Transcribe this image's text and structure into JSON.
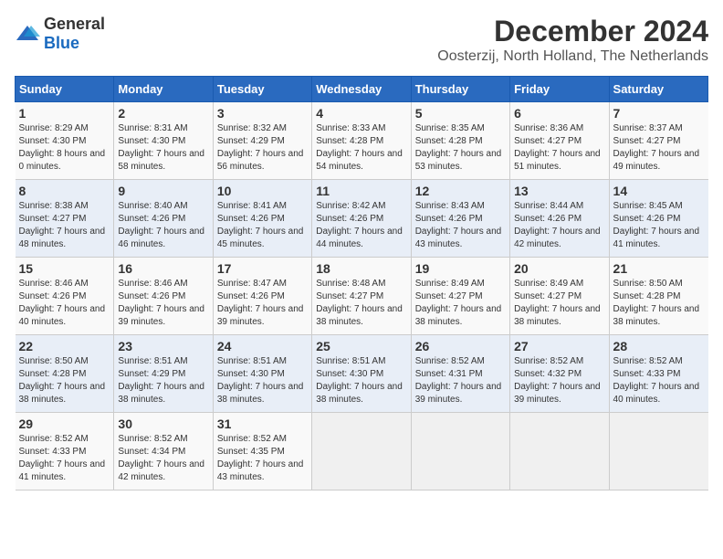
{
  "header": {
    "logo_general": "General",
    "logo_blue": "Blue",
    "main_title": "December 2024",
    "subtitle": "Oosterzij, North Holland, The Netherlands"
  },
  "calendar": {
    "weekdays": [
      "Sunday",
      "Monday",
      "Tuesday",
      "Wednesday",
      "Thursday",
      "Friday",
      "Saturday"
    ],
    "weeks": [
      [
        {
          "day": "1",
          "sunrise": "Sunrise: 8:29 AM",
          "sunset": "Sunset: 4:30 PM",
          "daylight": "Daylight: 8 hours and 0 minutes."
        },
        {
          "day": "2",
          "sunrise": "Sunrise: 8:31 AM",
          "sunset": "Sunset: 4:30 PM",
          "daylight": "Daylight: 7 hours and 58 minutes."
        },
        {
          "day": "3",
          "sunrise": "Sunrise: 8:32 AM",
          "sunset": "Sunset: 4:29 PM",
          "daylight": "Daylight: 7 hours and 56 minutes."
        },
        {
          "day": "4",
          "sunrise": "Sunrise: 8:33 AM",
          "sunset": "Sunset: 4:28 PM",
          "daylight": "Daylight: 7 hours and 54 minutes."
        },
        {
          "day": "5",
          "sunrise": "Sunrise: 8:35 AM",
          "sunset": "Sunset: 4:28 PM",
          "daylight": "Daylight: 7 hours and 53 minutes."
        },
        {
          "day": "6",
          "sunrise": "Sunrise: 8:36 AM",
          "sunset": "Sunset: 4:27 PM",
          "daylight": "Daylight: 7 hours and 51 minutes."
        },
        {
          "day": "7",
          "sunrise": "Sunrise: 8:37 AM",
          "sunset": "Sunset: 4:27 PM",
          "daylight": "Daylight: 7 hours and 49 minutes."
        }
      ],
      [
        {
          "day": "8",
          "sunrise": "Sunrise: 8:38 AM",
          "sunset": "Sunset: 4:27 PM",
          "daylight": "Daylight: 7 hours and 48 minutes."
        },
        {
          "day": "9",
          "sunrise": "Sunrise: 8:40 AM",
          "sunset": "Sunset: 4:26 PM",
          "daylight": "Daylight: 7 hours and 46 minutes."
        },
        {
          "day": "10",
          "sunrise": "Sunrise: 8:41 AM",
          "sunset": "Sunset: 4:26 PM",
          "daylight": "Daylight: 7 hours and 45 minutes."
        },
        {
          "day": "11",
          "sunrise": "Sunrise: 8:42 AM",
          "sunset": "Sunset: 4:26 PM",
          "daylight": "Daylight: 7 hours and 44 minutes."
        },
        {
          "day": "12",
          "sunrise": "Sunrise: 8:43 AM",
          "sunset": "Sunset: 4:26 PM",
          "daylight": "Daylight: 7 hours and 43 minutes."
        },
        {
          "day": "13",
          "sunrise": "Sunrise: 8:44 AM",
          "sunset": "Sunset: 4:26 PM",
          "daylight": "Daylight: 7 hours and 42 minutes."
        },
        {
          "day": "14",
          "sunrise": "Sunrise: 8:45 AM",
          "sunset": "Sunset: 4:26 PM",
          "daylight": "Daylight: 7 hours and 41 minutes."
        }
      ],
      [
        {
          "day": "15",
          "sunrise": "Sunrise: 8:46 AM",
          "sunset": "Sunset: 4:26 PM",
          "daylight": "Daylight: 7 hours and 40 minutes."
        },
        {
          "day": "16",
          "sunrise": "Sunrise: 8:46 AM",
          "sunset": "Sunset: 4:26 PM",
          "daylight": "Daylight: 7 hours and 39 minutes."
        },
        {
          "day": "17",
          "sunrise": "Sunrise: 8:47 AM",
          "sunset": "Sunset: 4:26 PM",
          "daylight": "Daylight: 7 hours and 39 minutes."
        },
        {
          "day": "18",
          "sunrise": "Sunrise: 8:48 AM",
          "sunset": "Sunset: 4:27 PM",
          "daylight": "Daylight: 7 hours and 38 minutes."
        },
        {
          "day": "19",
          "sunrise": "Sunrise: 8:49 AM",
          "sunset": "Sunset: 4:27 PM",
          "daylight": "Daylight: 7 hours and 38 minutes."
        },
        {
          "day": "20",
          "sunrise": "Sunrise: 8:49 AM",
          "sunset": "Sunset: 4:27 PM",
          "daylight": "Daylight: 7 hours and 38 minutes."
        },
        {
          "day": "21",
          "sunrise": "Sunrise: 8:50 AM",
          "sunset": "Sunset: 4:28 PM",
          "daylight": "Daylight: 7 hours and 38 minutes."
        }
      ],
      [
        {
          "day": "22",
          "sunrise": "Sunrise: 8:50 AM",
          "sunset": "Sunset: 4:28 PM",
          "daylight": "Daylight: 7 hours and 38 minutes."
        },
        {
          "day": "23",
          "sunrise": "Sunrise: 8:51 AM",
          "sunset": "Sunset: 4:29 PM",
          "daylight": "Daylight: 7 hours and 38 minutes."
        },
        {
          "day": "24",
          "sunrise": "Sunrise: 8:51 AM",
          "sunset": "Sunset: 4:30 PM",
          "daylight": "Daylight: 7 hours and 38 minutes."
        },
        {
          "day": "25",
          "sunrise": "Sunrise: 8:51 AM",
          "sunset": "Sunset: 4:30 PM",
          "daylight": "Daylight: 7 hours and 38 minutes."
        },
        {
          "day": "26",
          "sunrise": "Sunrise: 8:52 AM",
          "sunset": "Sunset: 4:31 PM",
          "daylight": "Daylight: 7 hours and 39 minutes."
        },
        {
          "day": "27",
          "sunrise": "Sunrise: 8:52 AM",
          "sunset": "Sunset: 4:32 PM",
          "daylight": "Daylight: 7 hours and 39 minutes."
        },
        {
          "day": "28",
          "sunrise": "Sunrise: 8:52 AM",
          "sunset": "Sunset: 4:33 PM",
          "daylight": "Daylight: 7 hours and 40 minutes."
        }
      ],
      [
        {
          "day": "29",
          "sunrise": "Sunrise: 8:52 AM",
          "sunset": "Sunset: 4:33 PM",
          "daylight": "Daylight: 7 hours and 41 minutes."
        },
        {
          "day": "30",
          "sunrise": "Sunrise: 8:52 AM",
          "sunset": "Sunset: 4:34 PM",
          "daylight": "Daylight: 7 hours and 42 minutes."
        },
        {
          "day": "31",
          "sunrise": "Sunrise: 8:52 AM",
          "sunset": "Sunset: 4:35 PM",
          "daylight": "Daylight: 7 hours and 43 minutes."
        },
        null,
        null,
        null,
        null
      ]
    ]
  }
}
